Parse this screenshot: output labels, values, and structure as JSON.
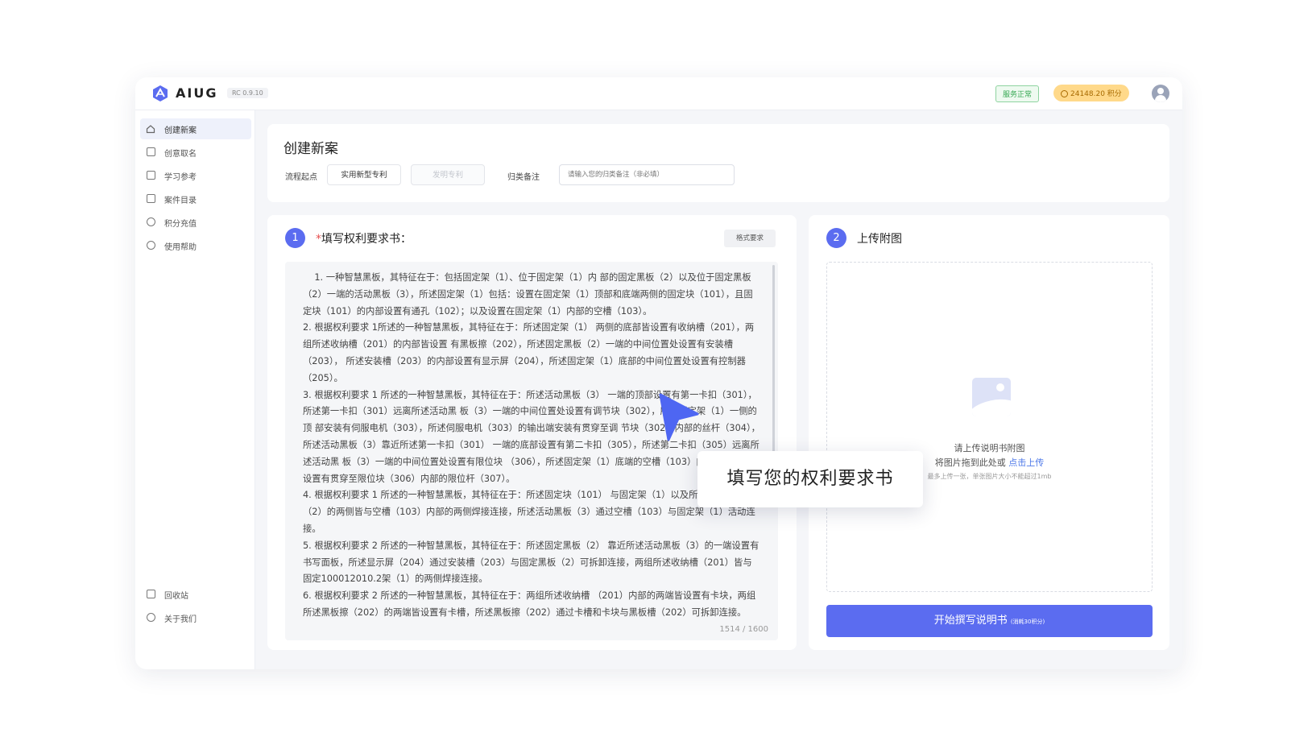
{
  "header": {
    "logo_text": "AIUG",
    "version": "RC 0.9.10",
    "status": "服务正常",
    "points": "24148.20 积分"
  },
  "sidebar": {
    "items": [
      {
        "label": "创建新案",
        "icon": "home-icon"
      },
      {
        "label": "创意取名",
        "icon": "tag-icon"
      },
      {
        "label": "学习参考",
        "icon": "book-icon"
      },
      {
        "label": "案件目录",
        "icon": "folder-icon"
      },
      {
        "label": "积分充值",
        "icon": "coin-icon"
      },
      {
        "label": "使用帮助",
        "icon": "help-icon"
      }
    ],
    "bottom_items": [
      {
        "label": "回收站",
        "icon": "trash-icon"
      },
      {
        "label": "关于我们",
        "icon": "info-icon"
      }
    ]
  },
  "form": {
    "title": "创建新案",
    "process_label": "流程起点",
    "option_utility": "实用新型专利",
    "option_invention": "发明专利",
    "note_label": "归类备注",
    "note_placeholder": "请输入您的归类备注（非必填）"
  },
  "claims": {
    "step": "1",
    "required_mark": "*",
    "title": "填写权利要求书：",
    "format_button": "格式要求",
    "text": "    1. 一种智慧黑板，其特征在于：包括固定架（1）、位于固定架（1）内 部的固定黑板（2）以及位于固定黑板（2）一端的活动黑板（3），所述固定架（1）包括：设置在固定架（1）顶部和底端两侧的固定块（101），且固定块（101）的内部设置有通孔（102）；以及设置在固定架（1）内部的空槽（103）。\n2. 根据权利要求 1所述的一种智慧黑板，其特征在于：所述固定架（1） 两侧的底部皆设置有收纳槽（201），两组所述收纳槽（201）的内部皆设置 有黑板擦（202），所述固定黑板（2）一端的中间位置处设置有安装槽（203）， 所述安装槽（203）的内部设置有显示屏（204），所述固定架（1）底部的中间位置处设置有控制器（205）。\n3. 根据权利要求 1 所述的一种智慧黑板，其特征在于：所述活动黑板（3） 一端的顶部设置有第一卡扣（301），所述第一卡扣（301）远离所述活动黑 板（3）一端的中间位置处设置有调节块（302），所述固定架（1）一侧的顶 部安装有伺服电机（303），所述伺服电机（303）的输出端安装有贯穿至调 节块（302）内部的丝杆（304），所述活动黑板（3）靠近所述第一卡扣（301） 一端的底部设置有第二卡扣（305），所述第二卡扣（305）远离所述活动黑 板（3）一端的中间位置处设置有限位块 （306），所述固定架（1）底端的空槽（103）内部一端的底部设置有贯穿至限位块（306）内部的限位杆（307）。\n4. 根据权利要求 1 所述的一种智慧黑板，其特征在于：所述固定块（101） 与固定架（1）以及所述固定黑板（2）的两侧皆与空槽（103）内部的两侧焊接连接，所述活动黑板（3）通过空槽（103）与固定架（1）活动连接。\n5. 根据权利要求 2 所述的一种智慧黑板，其特征在于：所述固定黑板（2） 靠近所述活动黑板（3）的一端设置有书写面板，所述显示屏（204）通过安装槽（203）与固定黑板（2）可拆卸连接，两组所述收纳槽（201）皆与固定100012010.2架（1）的两侧焊接连接。\n6. 根据权利要求 2 所述的一种智慧黑板，其特征在于：两组所述收纳槽 （201）内部的两端皆设置有卡块，两组所述黑板擦（202）的两端皆设置有卡槽，所述黑板擦（202）通过卡槽和卡块与黑板槽（202）可拆卸连接。",
    "counter": "1514 / 1600"
  },
  "upload": {
    "step": "2",
    "title": "上传附图",
    "prompt": "请上传说明书附图",
    "drag_text": "将图片拖到此处或",
    "link_text": "点击上传",
    "hint": "最多上传一张，单张图片大小不能超过1mb"
  },
  "action": {
    "start_label": "开始撰写说明书",
    "cost_note": "(消耗30积分)"
  },
  "callout": {
    "text": "填写您的权利要求书"
  },
  "colors": {
    "accent": "#5b6cf0",
    "status_green": "#36a852",
    "points_gold": "#ffd98a"
  }
}
